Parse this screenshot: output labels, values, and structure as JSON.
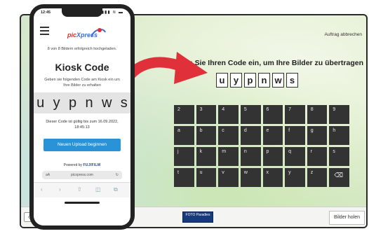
{
  "kiosk": {
    "abort_label": "Auftrag abbrechen",
    "headline": "Geben Sie Ihren Code ein, um Ihre Bilder zu übertragen",
    "code_letters": [
      "u",
      "y",
      "p",
      "n",
      "w",
      "s"
    ],
    "keypad_rows": [
      [
        "2",
        "3",
        "4",
        "5",
        "6",
        "7",
        "8",
        "9"
      ],
      [
        "a",
        "b",
        "c",
        "d",
        "e",
        "f",
        "g",
        "h"
      ],
      [
        "j",
        "k",
        "m",
        "n",
        "p",
        "q",
        "r",
        "s"
      ],
      [
        "t",
        "u",
        "v",
        "w",
        "x",
        "y",
        "z",
        "⌫"
      ]
    ],
    "promo_label": "FOTO Paradies",
    "fetch_button": "Bilder holen",
    "left_nav": "‹"
  },
  "phone": {
    "status_time": "12:45",
    "status_icons": "▮▮▮ ≋ ▬",
    "logo_text_a": "pic",
    "logo_text_b": "Xpress",
    "upload_status": "8 von 8 Bildern erfolgreich hochgeladen.",
    "page_title": "Kiosk Code",
    "instruction": "Geben sie folgenden Code am Kiosk ein um Ihre Bilder zu erhalten",
    "code_letters": [
      "u",
      "y",
      "p",
      "n",
      "w",
      "s"
    ],
    "validity": "Dieser Code ist gültig bis zum 16.09.2022, 18:45:13",
    "new_upload_button": "Neuen Upload beginnen",
    "powered_prefix": "Powered by",
    "powered_brand": "FUJIFILM",
    "url": "picxpress.com",
    "url_aa": "aA",
    "url_reload": "↻",
    "browser_icons": [
      "‹",
      "›",
      "⇧",
      "◫",
      "⧉"
    ]
  },
  "colors": {
    "accent_red": "#e0303a",
    "button_blue": "#2a93d8",
    "key_dark": "#333333"
  }
}
